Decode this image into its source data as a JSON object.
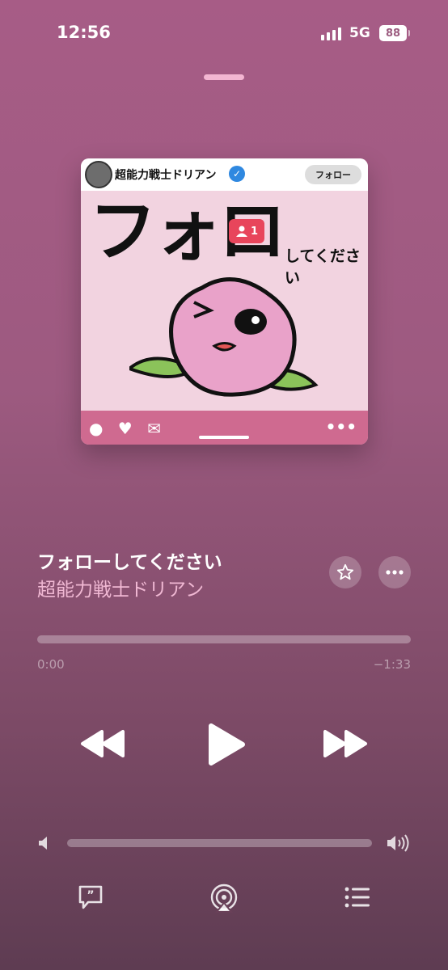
{
  "status_bar": {
    "time": "12:56",
    "network": "5G",
    "battery": "88"
  },
  "artwork": {
    "artist_label": "超能力戦士ドリアン",
    "follow_button": "フォロー",
    "title_big": "フォロ",
    "title_small": "してください",
    "notification_count": "1"
  },
  "now_playing": {
    "title": "フォローしてください",
    "artist": "超能力戦士ドリアン",
    "elapsed": "0:00",
    "remaining": "−1:33",
    "progress": 0.0,
    "volume": 0.0
  },
  "icons": {
    "star": "star-icon",
    "more": "ellipsis-icon",
    "rewind": "backward-icon",
    "play": "play-icon",
    "forward": "forward-icon",
    "lyrics": "lyrics-icon",
    "airplay": "airplay-icon",
    "queue": "queue-icon"
  },
  "colors": {
    "accent_pink": "#f0b8d3",
    "background_top": "#a75c86",
    "background_bottom": "#5e3c52"
  }
}
